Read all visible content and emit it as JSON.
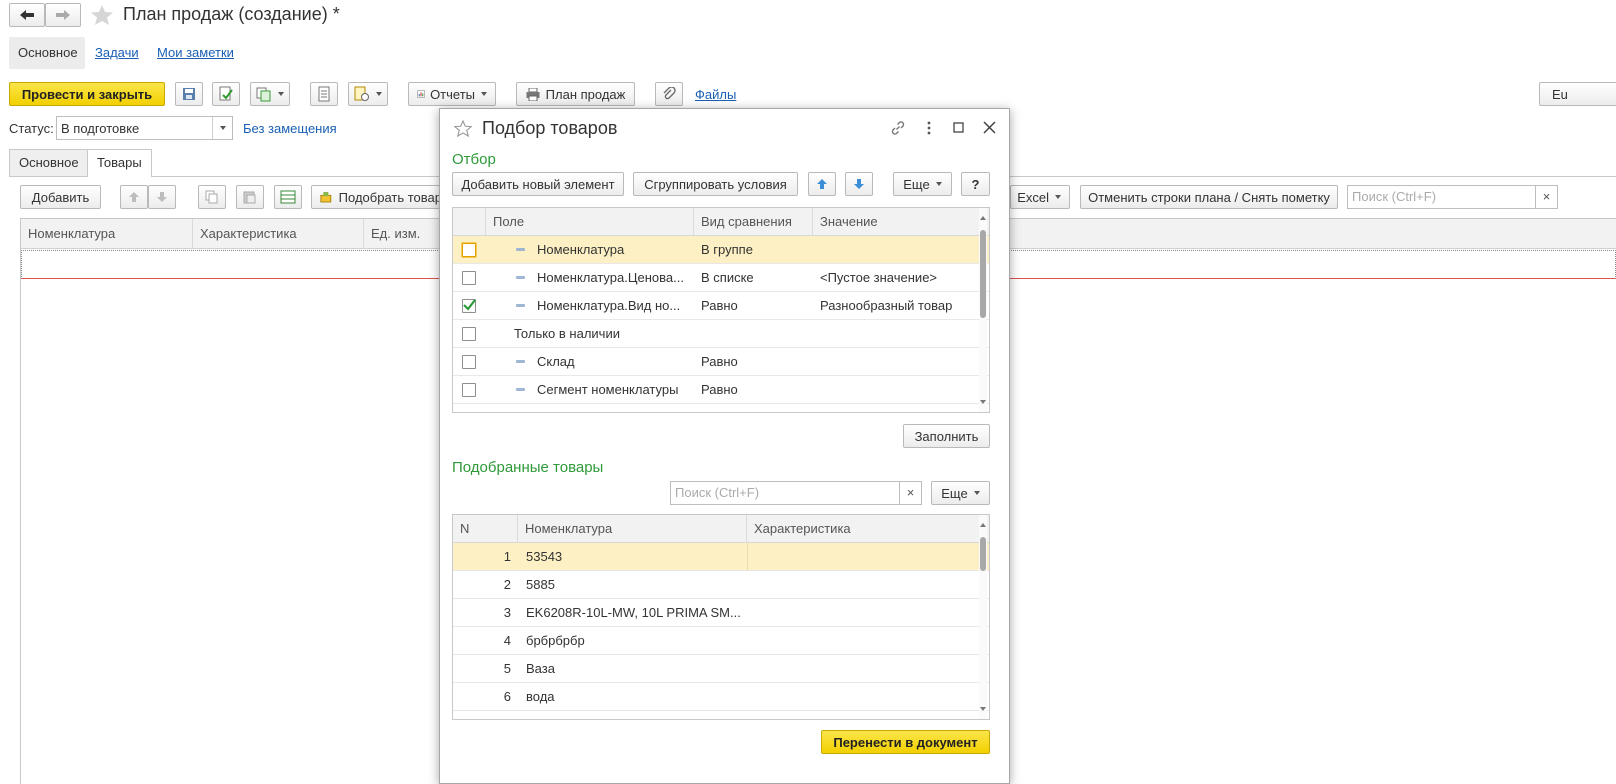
{
  "window": {
    "title": "План продаж (создание) *"
  },
  "nav_tabs": [
    "Основное",
    "Задачи",
    "Мои заметки"
  ],
  "toolbar": {
    "post_close": "Провести и закрыть",
    "reports": "Отчеты",
    "plan": "План продаж",
    "files": "Файлы",
    "more_cut": "Eu"
  },
  "status": {
    "label": "Статус:",
    "value": "В подготовке",
    "link": "Без замещения"
  },
  "form_tabs": [
    "Основное",
    "Товары"
  ],
  "goods_toolbar": {
    "add": "Добавить",
    "pick": "Подобрать товар",
    "excel": "Excel",
    "cancel_rows": "Отменить строки плана / Снять пометку",
    "search_placeholder": "Поиск (Ctrl+F)",
    "search_clear": "×"
  },
  "goods_columns": [
    "Номенклатура",
    "Характеристика",
    "Ед. изм."
  ],
  "dialog": {
    "title": "Подбор товаров",
    "filter_section": "Отбор",
    "add_element": "Добавить новый элемент",
    "group_conditions": "Сгруппировать условия",
    "more": "Еще",
    "help": "?",
    "filter_columns": [
      "Поле",
      "Вид сравнения",
      "Значение"
    ],
    "filter_rows": [
      {
        "checked": false,
        "field": "Номенклатура",
        "comparison": "В группе",
        "value": "",
        "indent": true
      },
      {
        "checked": false,
        "field": "Номенклатура.Ценова...",
        "comparison": "В списке",
        "value": "<Пустое значение>",
        "indent": true
      },
      {
        "checked": true,
        "field": "Номенклатура.Вид но...",
        "comparison": "Равно",
        "value": "Разнообразный товар",
        "indent": true
      },
      {
        "checked": false,
        "field": "Только в наличии",
        "comparison": "",
        "value": "",
        "indent": false
      },
      {
        "checked": false,
        "field": "Склад",
        "comparison": "Равно",
        "value": "",
        "indent": true
      },
      {
        "checked": false,
        "field": "Сегмент номенклатуры",
        "comparison": "Равно",
        "value": "",
        "indent": true
      }
    ],
    "fill": "Заполнить",
    "selected_section": "Подобранные товары",
    "search_placeholder": "Поиск (Ctrl+F)",
    "search_clear": "×",
    "selected_columns": [
      "N",
      "Номенклатура",
      "Характеристика"
    ],
    "selected_rows": [
      {
        "n": "1",
        "name": "53543",
        "char": ""
      },
      {
        "n": "2",
        "name": "5885",
        "char": ""
      },
      {
        "n": "3",
        "name": "EK6208R-10L-MW, 10L PRIMA SM...",
        "char": ""
      },
      {
        "n": "4",
        "name": "брбрбрбр",
        "char": ""
      },
      {
        "n": "5",
        "name": "Ваза",
        "char": ""
      },
      {
        "n": "6",
        "name": "вода",
        "char": ""
      }
    ],
    "transfer": "Перенести в документ"
  },
  "colors": {
    "accent_yellow": "#f2d000",
    "section_green": "#2e9a3a",
    "link_blue": "#1a5fb4",
    "selected_row": "#fdf0c4"
  }
}
